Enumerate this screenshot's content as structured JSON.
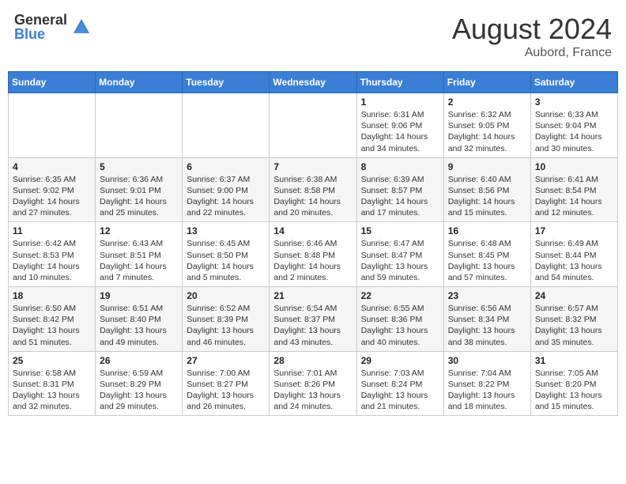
{
  "header": {
    "logo_general": "General",
    "logo_blue": "Blue",
    "month_year": "August 2024",
    "location": "Aubord, France"
  },
  "weekdays": [
    "Sunday",
    "Monday",
    "Tuesday",
    "Wednesday",
    "Thursday",
    "Friday",
    "Saturday"
  ],
  "weeks": [
    [
      {
        "day": "",
        "info": ""
      },
      {
        "day": "",
        "info": ""
      },
      {
        "day": "",
        "info": ""
      },
      {
        "day": "",
        "info": ""
      },
      {
        "day": "1",
        "info": "Sunrise: 6:31 AM\nSunset: 9:06 PM\nDaylight: 14 hours\nand 34 minutes."
      },
      {
        "day": "2",
        "info": "Sunrise: 6:32 AM\nSunset: 9:05 PM\nDaylight: 14 hours\nand 32 minutes."
      },
      {
        "day": "3",
        "info": "Sunrise: 6:33 AM\nSunset: 9:04 PM\nDaylight: 14 hours\nand 30 minutes."
      }
    ],
    [
      {
        "day": "4",
        "info": "Sunrise: 6:35 AM\nSunset: 9:02 PM\nDaylight: 14 hours\nand 27 minutes."
      },
      {
        "day": "5",
        "info": "Sunrise: 6:36 AM\nSunset: 9:01 PM\nDaylight: 14 hours\nand 25 minutes."
      },
      {
        "day": "6",
        "info": "Sunrise: 6:37 AM\nSunset: 9:00 PM\nDaylight: 14 hours\nand 22 minutes."
      },
      {
        "day": "7",
        "info": "Sunrise: 6:38 AM\nSunset: 8:58 PM\nDaylight: 14 hours\nand 20 minutes."
      },
      {
        "day": "8",
        "info": "Sunrise: 6:39 AM\nSunset: 8:57 PM\nDaylight: 14 hours\nand 17 minutes."
      },
      {
        "day": "9",
        "info": "Sunrise: 6:40 AM\nSunset: 8:56 PM\nDaylight: 14 hours\nand 15 minutes."
      },
      {
        "day": "10",
        "info": "Sunrise: 6:41 AM\nSunset: 8:54 PM\nDaylight: 14 hours\nand 12 minutes."
      }
    ],
    [
      {
        "day": "11",
        "info": "Sunrise: 6:42 AM\nSunset: 8:53 PM\nDaylight: 14 hours\nand 10 minutes."
      },
      {
        "day": "12",
        "info": "Sunrise: 6:43 AM\nSunset: 8:51 PM\nDaylight: 14 hours\nand 7 minutes."
      },
      {
        "day": "13",
        "info": "Sunrise: 6:45 AM\nSunset: 8:50 PM\nDaylight: 14 hours\nand 5 minutes."
      },
      {
        "day": "14",
        "info": "Sunrise: 6:46 AM\nSunset: 8:48 PM\nDaylight: 14 hours\nand 2 minutes."
      },
      {
        "day": "15",
        "info": "Sunrise: 6:47 AM\nSunset: 8:47 PM\nDaylight: 13 hours\nand 59 minutes."
      },
      {
        "day": "16",
        "info": "Sunrise: 6:48 AM\nSunset: 8:45 PM\nDaylight: 13 hours\nand 57 minutes."
      },
      {
        "day": "17",
        "info": "Sunrise: 6:49 AM\nSunset: 8:44 PM\nDaylight: 13 hours\nand 54 minutes."
      }
    ],
    [
      {
        "day": "18",
        "info": "Sunrise: 6:50 AM\nSunset: 8:42 PM\nDaylight: 13 hours\nand 51 minutes."
      },
      {
        "day": "19",
        "info": "Sunrise: 6:51 AM\nSunset: 8:40 PM\nDaylight: 13 hours\nand 49 minutes."
      },
      {
        "day": "20",
        "info": "Sunrise: 6:52 AM\nSunset: 8:39 PM\nDaylight: 13 hours\nand 46 minutes."
      },
      {
        "day": "21",
        "info": "Sunrise: 6:54 AM\nSunset: 8:37 PM\nDaylight: 13 hours\nand 43 minutes."
      },
      {
        "day": "22",
        "info": "Sunrise: 6:55 AM\nSunset: 8:36 PM\nDaylight: 13 hours\nand 40 minutes."
      },
      {
        "day": "23",
        "info": "Sunrise: 6:56 AM\nSunset: 8:34 PM\nDaylight: 13 hours\nand 38 minutes."
      },
      {
        "day": "24",
        "info": "Sunrise: 6:57 AM\nSunset: 8:32 PM\nDaylight: 13 hours\nand 35 minutes."
      }
    ],
    [
      {
        "day": "25",
        "info": "Sunrise: 6:58 AM\nSunset: 8:31 PM\nDaylight: 13 hours\nand 32 minutes."
      },
      {
        "day": "26",
        "info": "Sunrise: 6:59 AM\nSunset: 8:29 PM\nDaylight: 13 hours\nand 29 minutes."
      },
      {
        "day": "27",
        "info": "Sunrise: 7:00 AM\nSunset: 8:27 PM\nDaylight: 13 hours\nand 26 minutes."
      },
      {
        "day": "28",
        "info": "Sunrise: 7:01 AM\nSunset: 8:26 PM\nDaylight: 13 hours\nand 24 minutes."
      },
      {
        "day": "29",
        "info": "Sunrise: 7:03 AM\nSunset: 8:24 PM\nDaylight: 13 hours\nand 21 minutes."
      },
      {
        "day": "30",
        "info": "Sunrise: 7:04 AM\nSunset: 8:22 PM\nDaylight: 13 hours\nand 18 minutes."
      },
      {
        "day": "31",
        "info": "Sunrise: 7:05 AM\nSunset: 8:20 PM\nDaylight: 13 hours\nand 15 minutes."
      }
    ]
  ]
}
